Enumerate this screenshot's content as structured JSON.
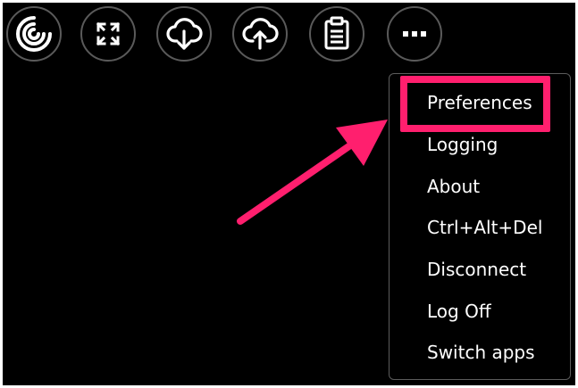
{
  "toolbar": {
    "buttons": [
      {
        "name": "citrix-logo-icon"
      },
      {
        "name": "fullscreen-icon"
      },
      {
        "name": "cloud-download-icon"
      },
      {
        "name": "cloud-upload-icon"
      },
      {
        "name": "clipboard-icon"
      },
      {
        "name": "more-icon"
      }
    ]
  },
  "menu": {
    "items": [
      {
        "label": "Preferences"
      },
      {
        "label": "Logging"
      },
      {
        "label": "About"
      },
      {
        "label": "Ctrl+Alt+Del"
      },
      {
        "label": "Disconnect"
      },
      {
        "label": "Log Off"
      },
      {
        "label": "Switch apps"
      }
    ]
  },
  "colors": {
    "background": "#000000",
    "highlight": "#ff1f6e",
    "text": "#ffffff",
    "button_border": "#5a5a5a"
  }
}
